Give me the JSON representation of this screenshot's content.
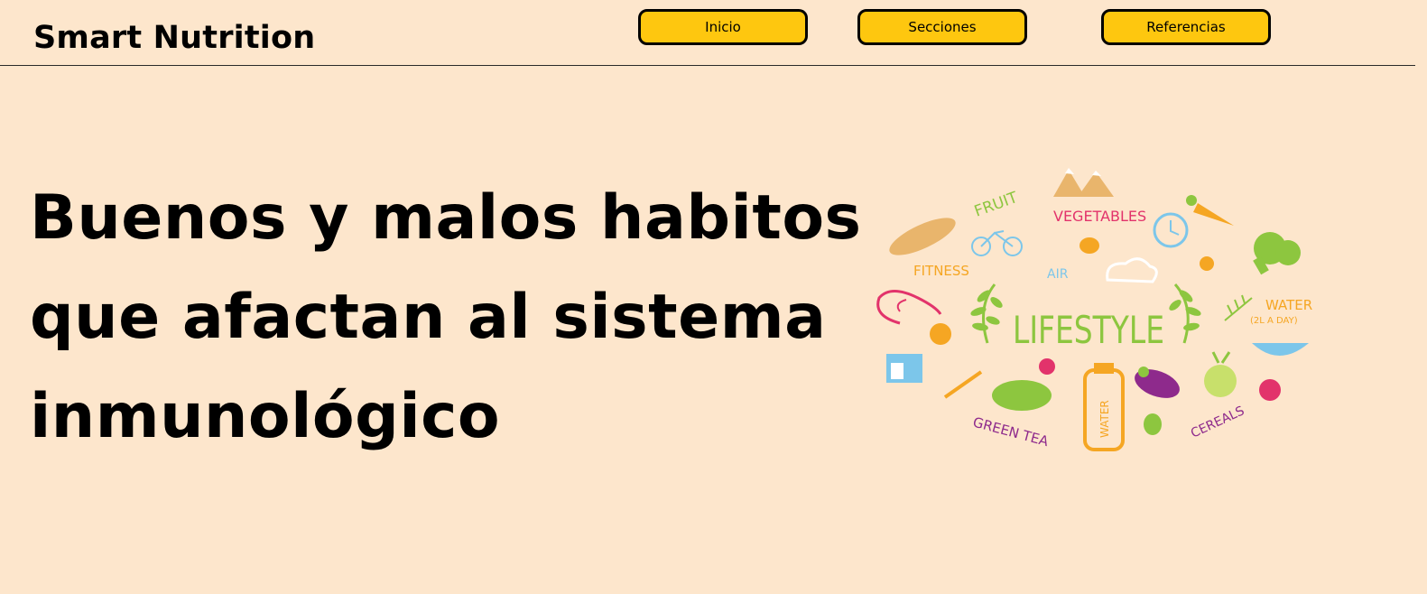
{
  "header": {
    "brand": "Smart Nutrition",
    "nav": {
      "inicio": "Inicio",
      "secciones": "Secciones",
      "referencias": "Referencias"
    }
  },
  "hero": {
    "title_lines": [
      "Buenos y malos habitos",
      "que afactan al sistema",
      "inmunológico"
    ]
  },
  "illustration": {
    "center_word": "LIFESTYLE",
    "words": {
      "fruit": "FRUIT",
      "vegetables": "VEGETABLES",
      "fitness": "FITNESS",
      "air": "AIR",
      "water": "WATER",
      "water_sub": "(2L A DAY)",
      "green_tea": "GREEN TEA",
      "bottle_label": "WATER",
      "cereals": "CEREALS"
    },
    "colors": {
      "green": "#8dc63f",
      "pink": "#e2336b",
      "orange": "#f5a623",
      "blue": "#7cc6ea",
      "purple": "#8e2a8c",
      "tan": "#e9b56c"
    }
  },
  "colors": {
    "background": "#fde6cc",
    "button": "#fec70f"
  }
}
